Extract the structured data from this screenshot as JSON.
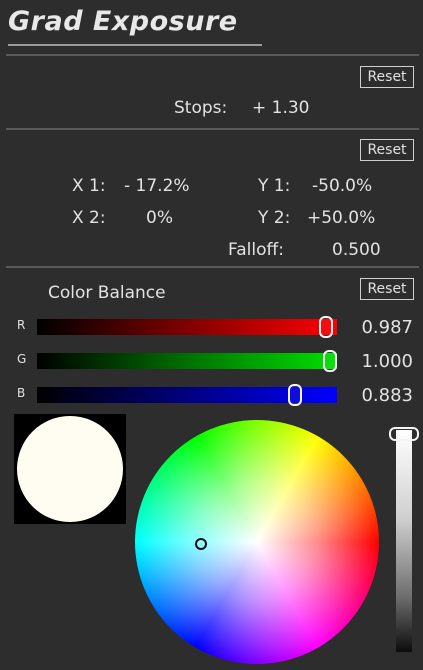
{
  "title": "Grad Exposure",
  "reset_label": "Reset",
  "exposure": {
    "label": "Stops:",
    "value": "+ 1.30"
  },
  "gradient": {
    "x1_label": "X 1:",
    "x1_value": "- 17.2%",
    "y1_label": "Y 1:",
    "y1_value": "-50.0%",
    "x2_label": "X 2:",
    "x2_value": "0%",
    "y2_label": "Y 2:",
    "y2_value": "+50.0%",
    "falloff_label": "Falloff:",
    "falloff_value": "0.500"
  },
  "color_balance": {
    "label": "Color Balance",
    "channels": [
      {
        "label": "R",
        "value": "0.987",
        "fraction": 0.987,
        "color": "#ff0000"
      },
      {
        "label": "G",
        "value": "1.000",
        "fraction": 1.0,
        "color": "#00dd00"
      },
      {
        "label": "B",
        "value": "0.883",
        "fraction": 0.883,
        "color": "#0000ff"
      }
    ],
    "preview_color": "#fffdf2"
  }
}
